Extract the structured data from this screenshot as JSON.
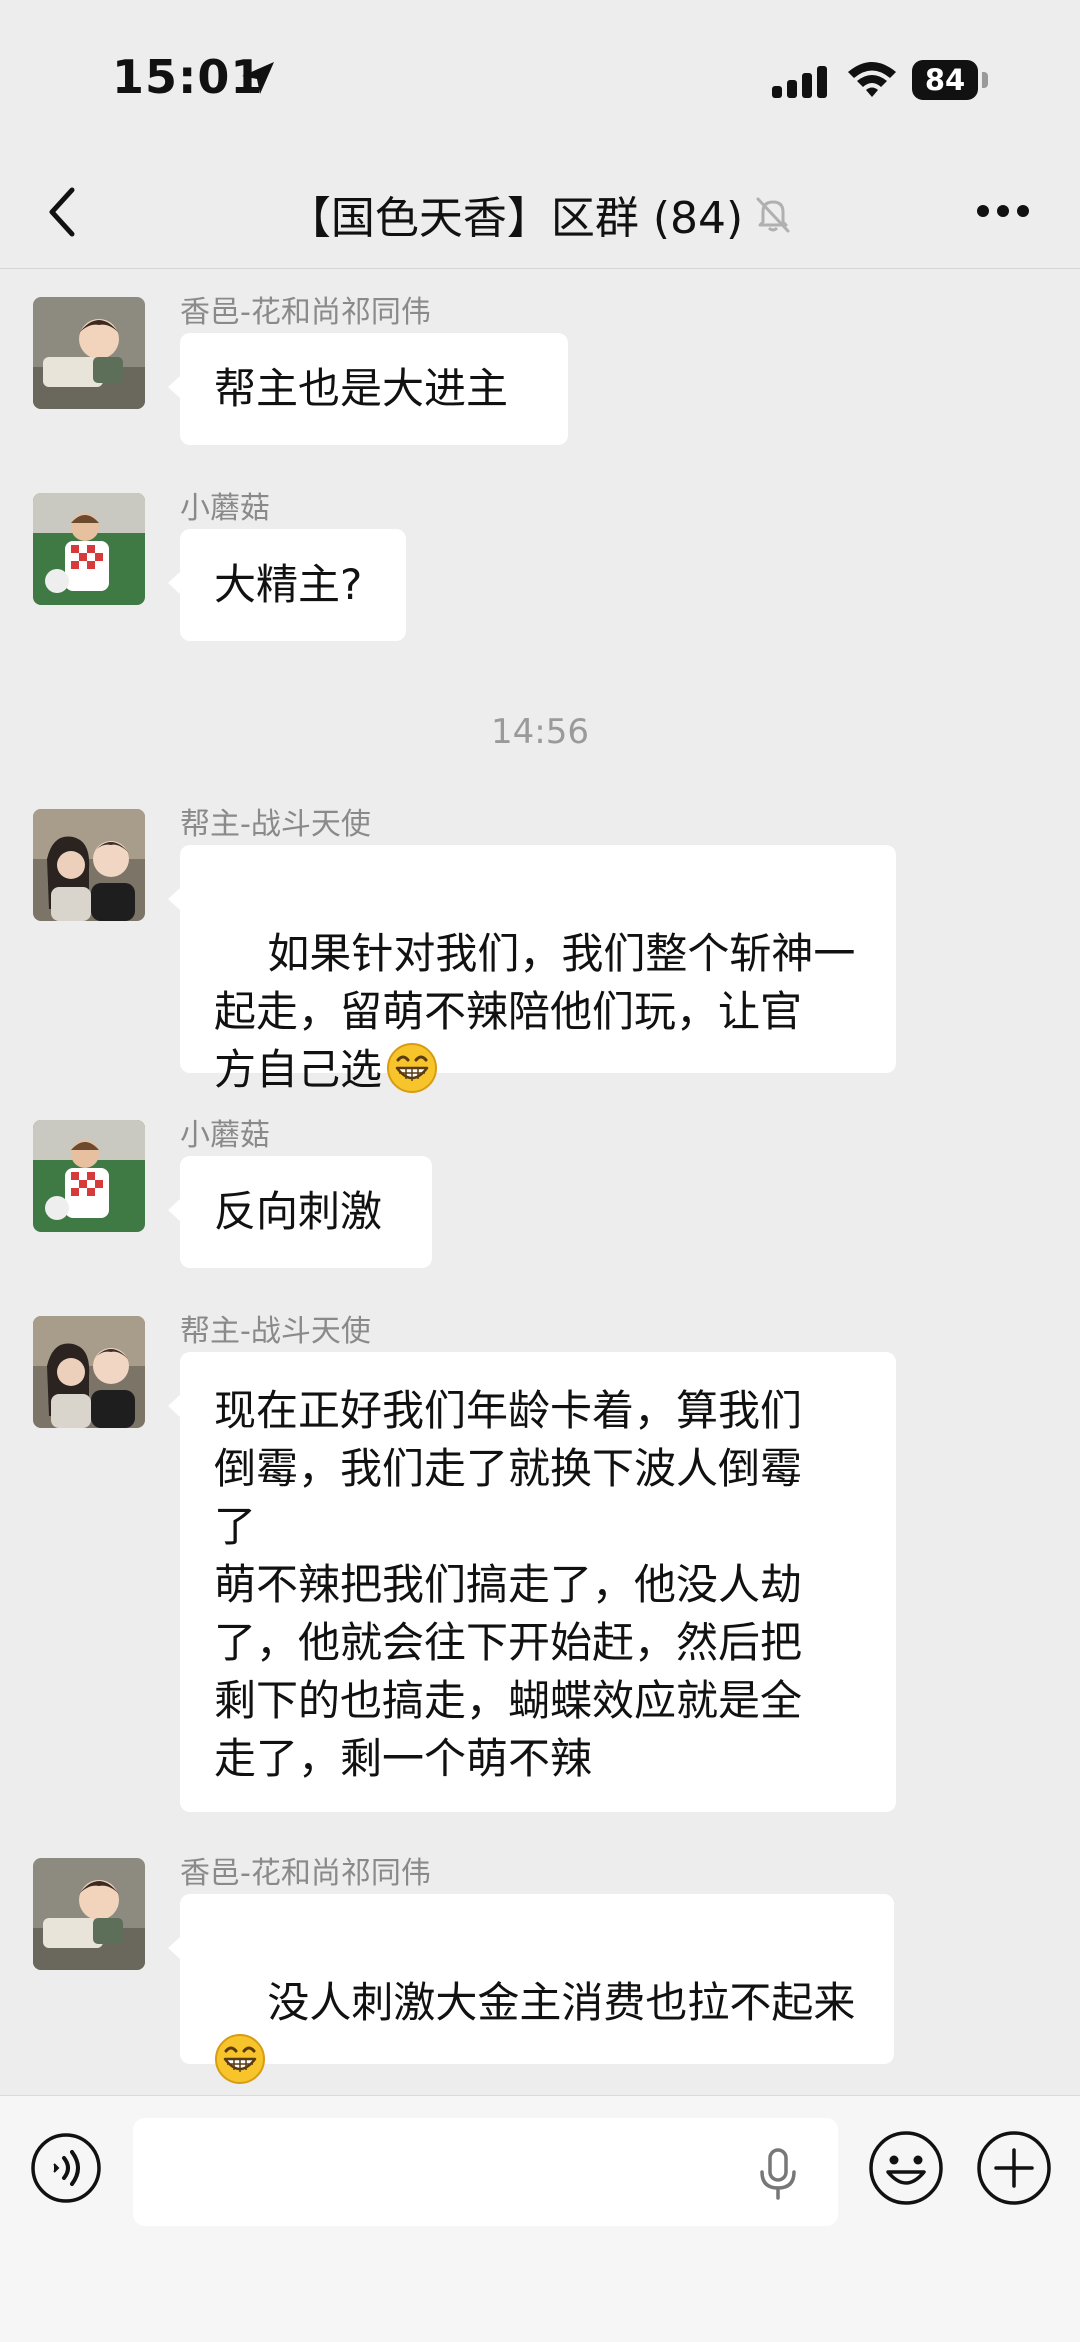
{
  "status_bar": {
    "time": "15:01",
    "battery": "84"
  },
  "header": {
    "title": "【国色天香】区群 (84)"
  },
  "messages": [
    {
      "sender": "香邑-花和尚祁同伟",
      "text": "帮主也是大进主"
    },
    {
      "sender": "小蘑菇",
      "text": "大精主?"
    },
    {
      "timestamp": "14:56"
    },
    {
      "sender": "帮主-战斗天使",
      "text": "如果针对我们，我们整个斩神一\n起走，留萌不辣陪他们玩，让官\n方自己选",
      "emoji": "grin"
    },
    {
      "sender": "小蘑菇",
      "text": "反向刺激"
    },
    {
      "sender": "帮主-战斗天使",
      "text": "现在正好我们年龄卡着，算我们\n倒霉，我们走了就换下波人倒霉\n了\n萌不辣把我们搞走了，他没人劫\n了，他就会往下开始赶，然后把\n剩下的也搞走，蝴蝶效应就是全\n走了，剩一个萌不辣"
    },
    {
      "sender": "香邑-花和尚祁同伟",
      "text": "没人刺激大金主消费也拉不起来\n",
      "emoji": "grin"
    }
  ],
  "input_bar": {
    "value": "",
    "placeholder": ""
  },
  "icons": {
    "back": "chevron-left-icon",
    "mute": "bell-slash-icon",
    "more": "more-dots-icon",
    "voice": "voice-mode-icon",
    "mic": "microphone-icon",
    "emoji": "smiley-icon",
    "plus": "plus-circle-icon"
  }
}
